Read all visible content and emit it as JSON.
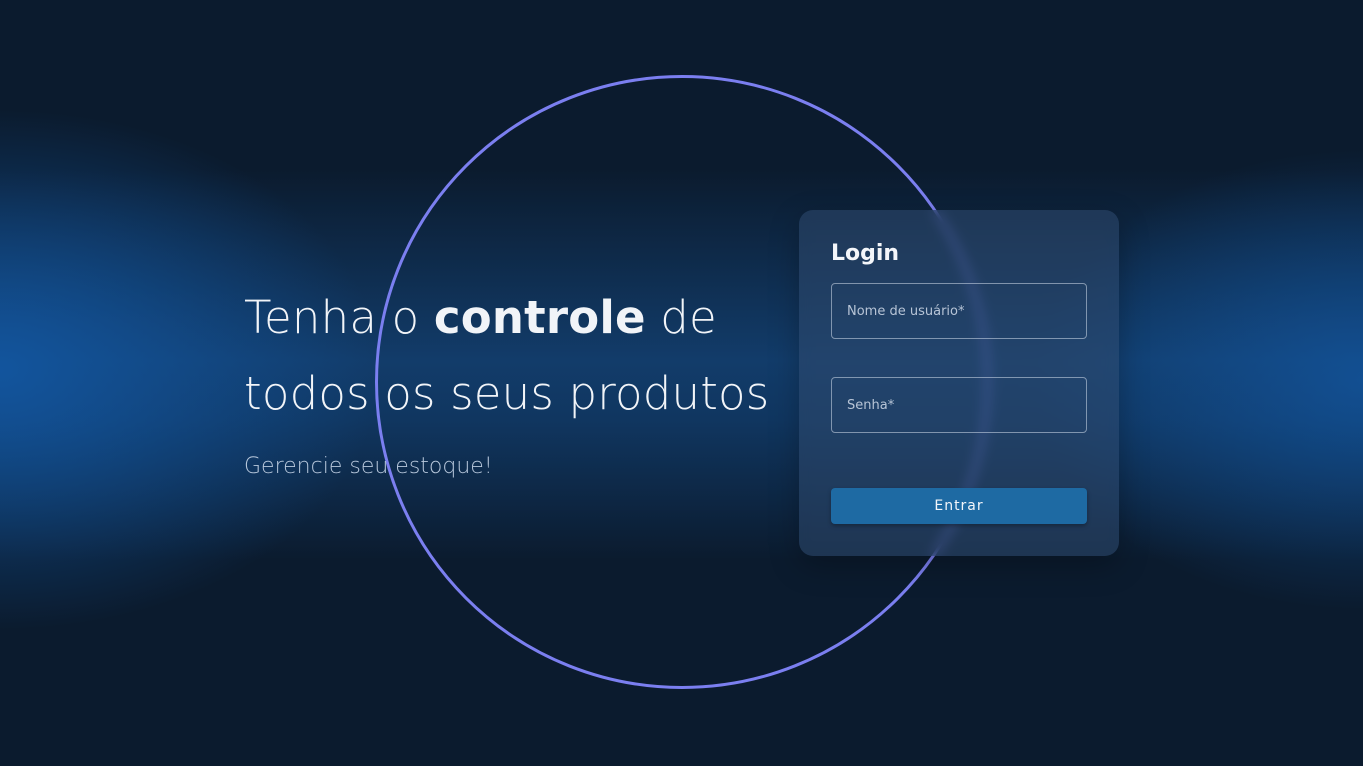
{
  "hero": {
    "line1_pre": "Tenha o ",
    "line1_strong": "controle",
    "line1_post": " de",
    "line2": "todos os seus produtos",
    "subtitle": "Gerencie seu estoque!"
  },
  "login": {
    "title": "Login",
    "username_placeholder": "Nome de usuário*",
    "password_placeholder": "Senha*",
    "submit_label": "Entrar"
  },
  "colors": {
    "background": "#0b1b2e",
    "glow": "#12569f",
    "ring": "#7b7ff0",
    "button": "#1e6aa3",
    "card": "#304a70"
  }
}
